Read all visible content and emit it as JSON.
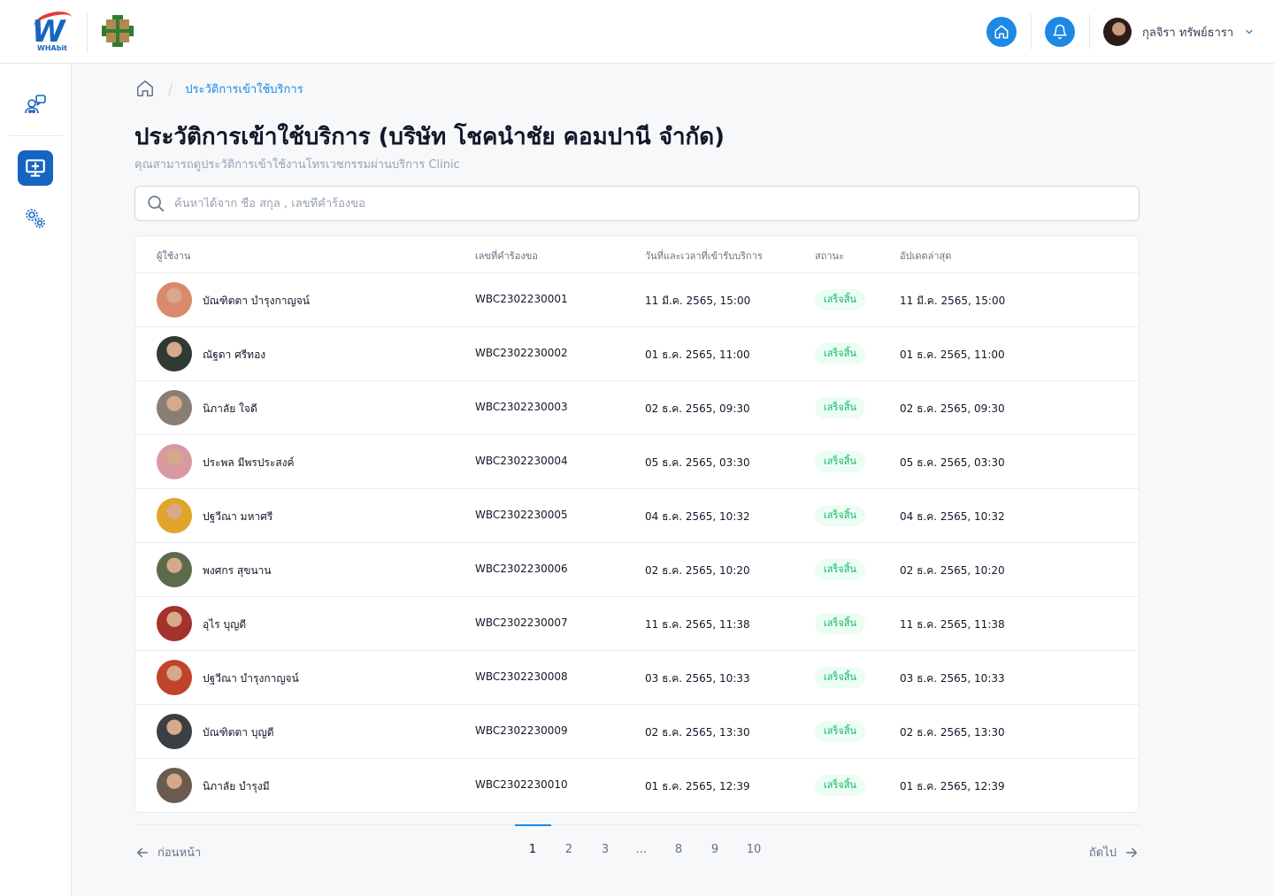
{
  "app": {
    "brand": "WHAbit",
    "colors": {
      "primary": "#1e88e5",
      "primary_dark": "#1565c0",
      "success_bg": "#ecfdf3",
      "success_text": "#12b76a"
    }
  },
  "header": {
    "user_name": "กุลจิรา ทรัพย์ธารา",
    "icons": [
      "home-icon",
      "bell-icon",
      "chevron-down-icon"
    ]
  },
  "sidebar": {
    "items": [
      {
        "name": "users-chat-icon",
        "active": false
      },
      {
        "name": "monitor-plus-icon",
        "active": true
      },
      {
        "name": "settings-gears-icon",
        "active": false
      }
    ]
  },
  "breadcrumb": {
    "separator": "/",
    "current": "ประวัติการเข้าใช้บริการ"
  },
  "page": {
    "title": "ประวัติการเข้าใช้บริการ  (บริษัท โชคนำชัย คอมปานี จำกัด)",
    "subtitle": "คุณสามารถดูประวัติการเข้าใช้งานโทรเวชกรรมผ่านบริการ Clinic"
  },
  "search": {
    "placeholder": "ค้นหาได้จาก ชื่อ สกุล , เลขที่คำร้องขอ"
  },
  "table": {
    "headers": {
      "user": "ผู้ใช้งาน",
      "request_no": "เลขที่คำร้องขอ",
      "service_datetime": "วันที่และเวลาที่เข้ารับบริการ",
      "status": "สถานะ",
      "updated": "อัปเดตล่าสุด"
    },
    "rows": [
      {
        "name": "บัณฑิตตา บำรุงกาญจน์",
        "request_no": "WBC2302230001",
        "service": "11 มี.ค. 2565, 15:00",
        "status": "เสร็จสิ้น",
        "updated": "11 มี.ค. 2565, 15:00",
        "avatar_color": "#d98a6a"
      },
      {
        "name": "ณัฐดา ศรีทอง",
        "request_no": "WBC2302230002",
        "service": "01 ธ.ค. 2565, 11:00",
        "status": "เสร็จสิ้น",
        "updated": "01 ธ.ค. 2565, 11:00",
        "avatar_color": "#2f3a34"
      },
      {
        "name": "นิภาลัย ใจดี",
        "request_no": "WBC2302230003",
        "service": "02 ธ.ค. 2565, 09:30",
        "status": "เสร็จสิ้น",
        "updated": "02 ธ.ค. 2565, 09:30",
        "avatar_color": "#8a7d74"
      },
      {
        "name": "ประพล มีพรประสงค์",
        "request_no": "WBC2302230004",
        "service": "05 ธ.ค. 2565, 03:30",
        "status": "เสร็จสิ้น",
        "updated": "05 ธ.ค. 2565, 03:30",
        "avatar_color": "#d89aa0"
      },
      {
        "name": "ปฐวีณา มหาศรี",
        "request_no": "WBC2302230005",
        "service": "04 ธ.ค. 2565, 10:32",
        "status": "เสร็จสิ้น",
        "updated": "04 ธ.ค. 2565, 10:32",
        "avatar_color": "#e0a52a"
      },
      {
        "name": "พงศกร สุขนาน",
        "request_no": "WBC2302230006",
        "service": "02 ธ.ค. 2565, 10:20",
        "status": "เสร็จสิ้น",
        "updated": "02 ธ.ค. 2565, 10:20",
        "avatar_color": "#5e6a4e"
      },
      {
        "name": "อุไร บุญดี",
        "request_no": "WBC2302230007",
        "service": "11 ธ.ค. 2565, 11:38",
        "status": "เสร็จสิ้น",
        "updated": "11 ธ.ค. 2565, 11:38",
        "avatar_color": "#a3322c"
      },
      {
        "name": "ปฐวีณา บำรุงกาญจน์",
        "request_no": "WBC2302230008",
        "service": "03 ธ.ค. 2565, 10:33",
        "status": "เสร็จสิ้น",
        "updated": "03 ธ.ค. 2565, 10:33",
        "avatar_color": "#c0442a"
      },
      {
        "name": "บัณฑิตตา บุญดี",
        "request_no": "WBC2302230009",
        "service": "02 ธ.ค. 2565, 13:30",
        "status": "เสร็จสิ้น",
        "updated": "02 ธ.ค. 2565, 13:30",
        "avatar_color": "#3a3f44"
      },
      {
        "name": "นิภาลัย บำรุงมี",
        "request_no": "WBC2302230010",
        "service": "01 ธ.ค. 2565, 12:39",
        "status": "เสร็จสิ้น",
        "updated": "01 ธ.ค. 2565, 12:39",
        "avatar_color": "#6b5b4e"
      }
    ]
  },
  "pagination": {
    "prev_label": "ก่อนหน้า",
    "next_label": "ถัดไป",
    "pages": [
      "1",
      "2",
      "3",
      "...",
      "8",
      "9",
      "10"
    ],
    "current": "1"
  }
}
